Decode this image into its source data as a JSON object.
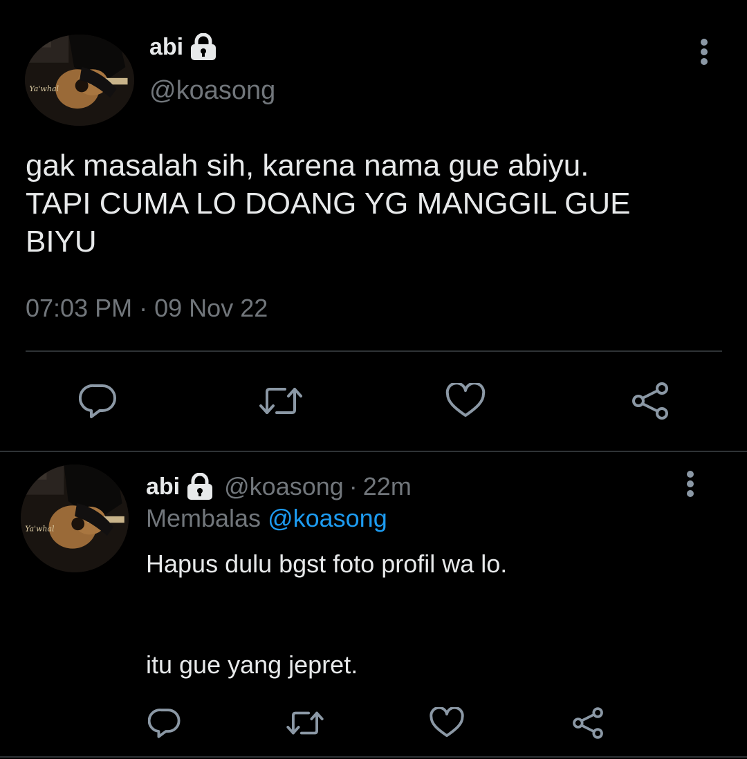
{
  "main_tweet": {
    "display_name": "abi",
    "handle": "@koasong",
    "text_lines": [
      "gak masalah sih, karena nama gue abiyu.",
      "TAPI CUMA LO DOANG YG MANGGIL GUE",
      "BIYU"
    ],
    "time": "07:03 PM",
    "separator": "·",
    "date": "09 Nov 22",
    "icons": {
      "lock": "lock-icon",
      "more": "more-vertical-icon",
      "reply": "reply-icon",
      "retweet": "retweet-icon",
      "like": "heart-icon",
      "share": "share-icon"
    }
  },
  "reply_tweet": {
    "display_name": "abi",
    "handle": "@koasong",
    "separator": "·",
    "age": "22m",
    "replying_prefix": "Membalas",
    "replying_to": "@koasong",
    "paragraph_1": "Hapus dulu bgst foto profil wa lo.",
    "paragraph_2": "itu gue yang jepret."
  },
  "colors": {
    "background": "#000000",
    "text": "#e7e9ea",
    "muted": "#71767b",
    "link": "#1d9bf0",
    "divider": "#2f3336",
    "icon": "#8b98a5"
  }
}
